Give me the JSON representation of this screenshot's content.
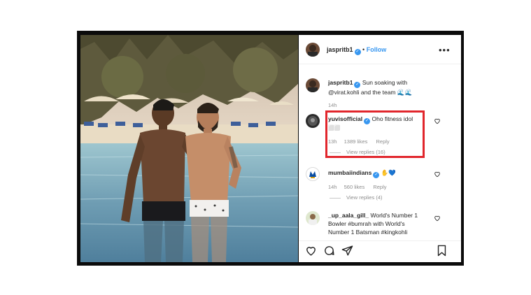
{
  "post": {
    "author": "jasprit",
    "author_suffix": "b1",
    "follow_label": "Follow",
    "more_icon": "ellipsis-icon"
  },
  "caption": {
    "author": "jaspritb1",
    "text_line1": "Sun soaking with",
    "text_line2": "@virat.kohli and the team",
    "emoji": "🌊🌊",
    "time": "14h"
  },
  "comments": [
    {
      "user": "yuvisofficial",
      "text_line1": "Oho fitness idol",
      "text_line2": "⬜⬜",
      "time": "13h",
      "likes": "1389 likes",
      "reply": "Reply",
      "view_replies": "View replies (16)"
    },
    {
      "user": "mumbaiindians",
      "emoji": "✋💙",
      "time": "14h",
      "likes": "560 likes",
      "reply": "Reply",
      "view_replies": "View replies (4)"
    },
    {
      "user": "_up_aala_gill_",
      "text_line1": "World's Number 1",
      "text_line2": "Bowler #bumrah with World's",
      "text_line3": "Number 1 Batsman #kingkohli"
    }
  ],
  "actions": [
    "heart-icon",
    "comment-icon",
    "share-icon",
    "bookmark-icon"
  ],
  "colors": {
    "highlight": "#e1262c",
    "verified": "#3897f0",
    "link": "#3897f0"
  }
}
